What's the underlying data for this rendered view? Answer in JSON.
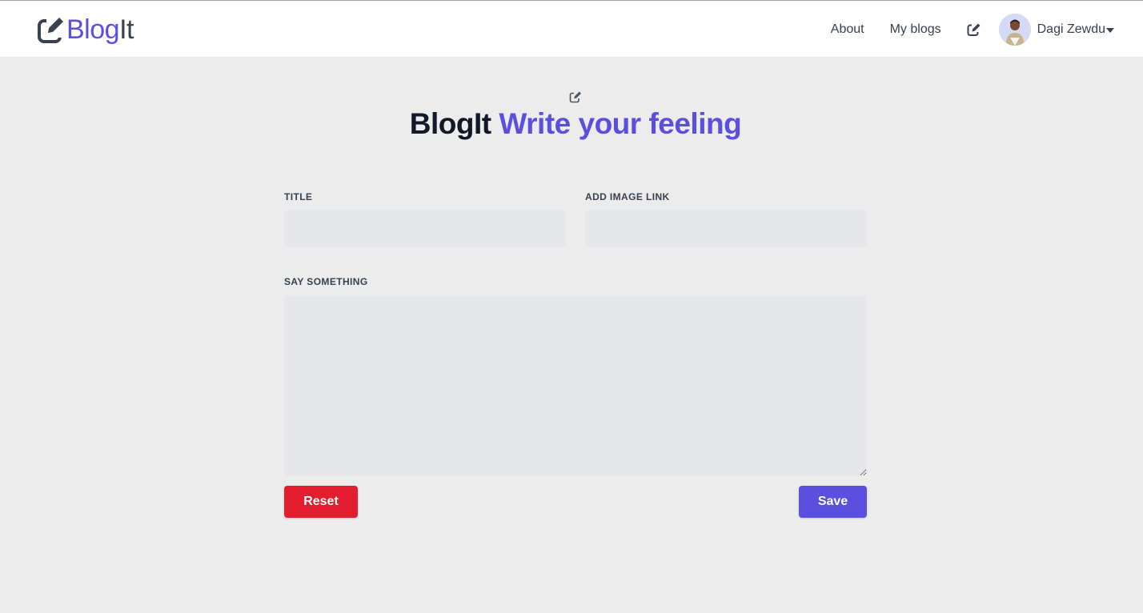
{
  "brand": {
    "name_part1": "Blog",
    "name_part2": "It",
    "icon": "pencil-square-icon",
    "accent_color": "#5b4fe0"
  },
  "nav": {
    "about": "About",
    "my_blogs": "My blogs",
    "write_icon": "pencil-square-icon",
    "user": {
      "name": "Dagi Zewdu",
      "avatar": "user-avatar",
      "menu_icon": "caret-down-icon"
    }
  },
  "heading": {
    "icon": "pencil-square-icon",
    "part1": "BlogIt",
    "part2": "Write your feeling"
  },
  "form": {
    "title_label": "TITLE",
    "title_value": "",
    "image_label": "ADD IMAGE LINK",
    "image_value": "",
    "body_label": "SAY SOMETHING",
    "body_value": "",
    "reset_label": "Reset",
    "save_label": "Save",
    "reset_color": "#e11d2e",
    "save_color": "#5b4fe0"
  }
}
